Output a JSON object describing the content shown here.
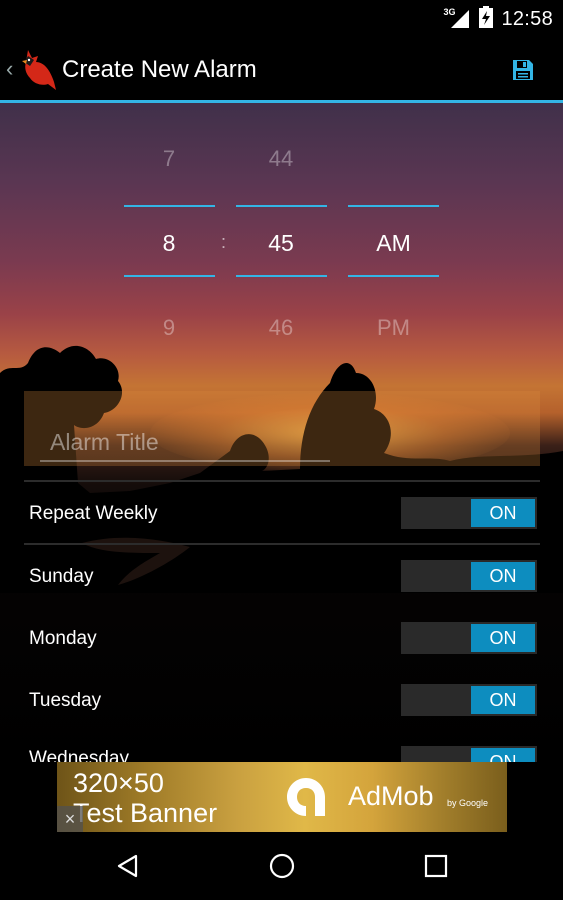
{
  "status_bar": {
    "network": "3G",
    "time": "12:58"
  },
  "action_bar": {
    "title": "Create New Alarm",
    "up_glyph": "‹",
    "app_icon": "cardinal-bird-icon",
    "save_icon": "save-icon"
  },
  "time_picker": {
    "hours": {
      "prev": "7",
      "selected": "8",
      "next": "9"
    },
    "separator": ":",
    "minutes": {
      "prev": "44",
      "selected": "45",
      "next": "46"
    },
    "ampm": {
      "prev": "",
      "selected": "AM",
      "next": "PM"
    }
  },
  "alarm_title": {
    "value": "",
    "placeholder": "Alarm Title"
  },
  "settings": {
    "repeat_weekly": {
      "label": "Repeat Weekly",
      "toggle": "ON"
    },
    "days": [
      {
        "label": "Sunday",
        "toggle": "ON"
      },
      {
        "label": "Monday",
        "toggle": "ON"
      },
      {
        "label": "Tuesday",
        "toggle": "ON"
      },
      {
        "label": "Wednesday",
        "toggle": "ON"
      }
    ]
  },
  "ad": {
    "line1": "320×50",
    "line2": "Test Banner",
    "brand": "AdMob",
    "by": "by Google",
    "close": "×"
  },
  "nav": {
    "back_icon": "back-icon",
    "home_icon": "home-icon",
    "recents_icon": "recents-icon"
  },
  "colors": {
    "accent": "#33b5e5",
    "toggle_on": "#0d8dbf",
    "ad_gold": "#c9a040"
  }
}
